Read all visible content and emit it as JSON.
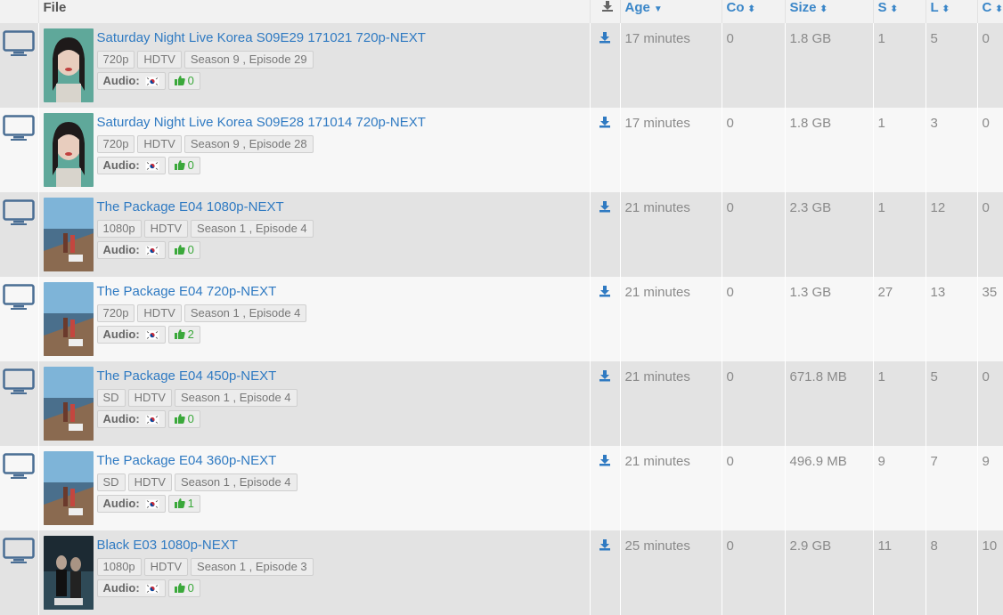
{
  "header": {
    "file": "File",
    "age": "Age",
    "co": "Co",
    "size": "Size",
    "s": "S",
    "l": "L",
    "c": "C"
  },
  "audio_label": "Audio:",
  "rows": [
    {
      "title": "Saturday Night Live Korea S09E29 171021 720p-NEXT",
      "res": "720p",
      "src": "HDTV",
      "ep": "Season 9 , Episode 29",
      "votes": "0",
      "age": "17 minutes",
      "co": "0",
      "size": "1.8 GB",
      "s": "1",
      "l": "5",
      "c": "0"
    },
    {
      "title": "Saturday Night Live Korea S09E28 171014 720p-NEXT",
      "res": "720p",
      "src": "HDTV",
      "ep": "Season 9 , Episode 28",
      "votes": "0",
      "age": "17 minutes",
      "co": "0",
      "size": "1.8 GB",
      "s": "1",
      "l": "3",
      "c": "0"
    },
    {
      "title": "The Package E04 1080p-NEXT",
      "res": "1080p",
      "src": "HDTV",
      "ep": "Season 1 , Episode 4",
      "votes": "0",
      "age": "21 minutes",
      "co": "0",
      "size": "2.3 GB",
      "s": "1",
      "l": "12",
      "c": "0"
    },
    {
      "title": "The Package E04 720p-NEXT",
      "res": "720p",
      "src": "HDTV",
      "ep": "Season 1 , Episode 4",
      "votes": "2",
      "age": "21 minutes",
      "co": "0",
      "size": "1.3 GB",
      "s": "27",
      "l": "13",
      "c": "35"
    },
    {
      "title": "The Package E04 450p-NEXT",
      "res": "SD",
      "src": "HDTV",
      "ep": "Season 1 , Episode 4",
      "votes": "0",
      "age": "21 minutes",
      "co": "0",
      "size": "671.8 MB",
      "s": "1",
      "l": "5",
      "c": "0"
    },
    {
      "title": "The Package E04 360p-NEXT",
      "res": "SD",
      "src": "HDTV",
      "ep": "Season 1 , Episode 4",
      "votes": "1",
      "age": "21 minutes",
      "co": "0",
      "size": "496.9 MB",
      "s": "9",
      "l": "7",
      "c": "9"
    },
    {
      "title": "Black E03 1080p-NEXT",
      "res": "1080p",
      "src": "HDTV",
      "ep": "Season 1 , Episode 3",
      "votes": "0",
      "age": "25 minutes",
      "co": "0",
      "size": "2.9 GB",
      "s": "11",
      "l": "8",
      "c": "10"
    }
  ],
  "colors": {
    "link": "#2f7ac2",
    "vote_green": "#3aa83a"
  },
  "icons": {
    "tv": "tv-icon",
    "download": "download-icon",
    "thumb": "thumbs-up-icon",
    "flag": "south-korea-flag-icon"
  }
}
